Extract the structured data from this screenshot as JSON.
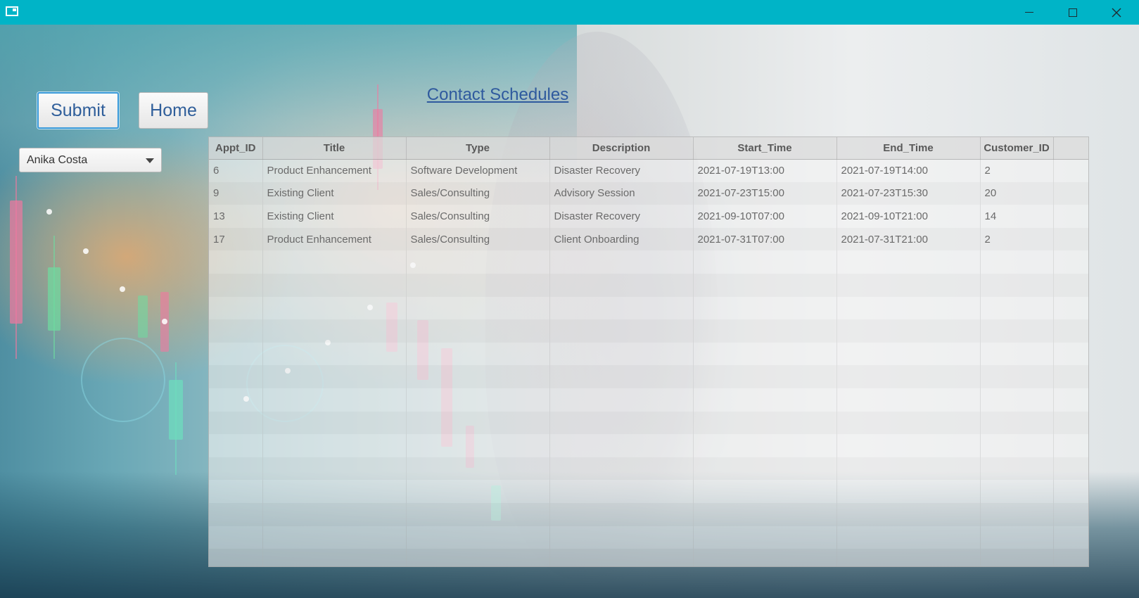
{
  "window": {
    "controls": {
      "minimize": "minimize",
      "maximize": "maximize",
      "close": "close"
    }
  },
  "toolbar": {
    "submit_label": "Submit",
    "home_label": "Home"
  },
  "page": {
    "title": "Contact Schedules"
  },
  "contact_select": {
    "selected": "Anika Costa"
  },
  "table": {
    "columns": [
      "Appt_ID",
      "Title",
      "Type",
      "Description",
      "Start_Time",
      "End_Time",
      "Customer_ID"
    ],
    "rows": [
      [
        "6",
        "Product Enhancement",
        "Software Development",
        "Disaster Recovery",
        "2021-07-19T13:00",
        "2021-07-19T14:00",
        "2"
      ],
      [
        "9",
        "Existing Client",
        "Sales/Consulting",
        "Advisory Session",
        "2021-07-23T15:00",
        "2021-07-23T15:30",
        "20"
      ],
      [
        "13",
        "Existing Client",
        "Sales/Consulting",
        "Disaster Recovery",
        "2021-09-10T07:00",
        "2021-09-10T21:00",
        "14"
      ],
      [
        "17",
        "Product Enhancement",
        "Sales/Consulting",
        "Client Onboarding",
        "2021-07-31T07:00",
        "2021-07-31T21:00",
        "2"
      ]
    ]
  },
  "colors": {
    "titlebar": "#00b4c7",
    "link": "#2f5a9e",
    "focus": "#3a9ad8"
  },
  "icons": {
    "app": "window-app-icon",
    "minimize": "minimize-icon",
    "maximize": "maximize-icon",
    "close": "close-icon",
    "dropdown": "chevron-down-icon"
  }
}
